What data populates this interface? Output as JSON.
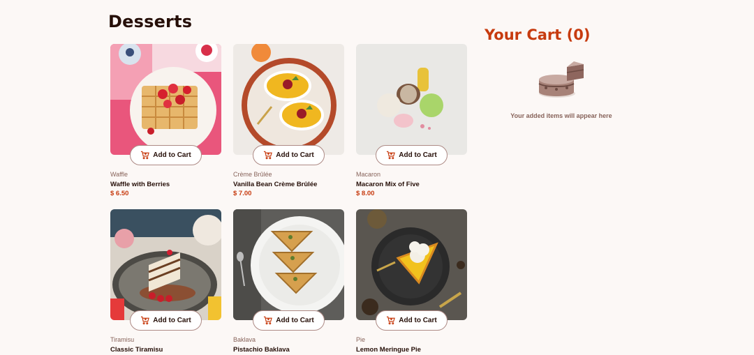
{
  "page": {
    "title": "Desserts"
  },
  "products": [
    {
      "category": "Waffle",
      "name": "Waffle with Berries",
      "price": "$ 6.50",
      "button": "Add to Cart"
    },
    {
      "category": "Crème Brûlée",
      "name": "Vanilla Bean Crème Brûlée",
      "price": "$ 7.00",
      "button": "Add to Cart"
    },
    {
      "category": "Macaron",
      "name": "Macaron Mix of Five",
      "price": "$ 8.00",
      "button": "Add to Cart"
    },
    {
      "category": "Tiramisu",
      "name": "Classic Tiramisu",
      "price": "",
      "button": "Add to Cart"
    },
    {
      "category": "Baklava",
      "name": "Pistachio Baklava",
      "price": "",
      "button": "Add to Cart"
    },
    {
      "category": "Pie",
      "name": "Lemon Meringue Pie",
      "price": "",
      "button": "Add to Cart"
    }
  ],
  "cart": {
    "title": "Your Cart (0)",
    "empty_message": "Your added items will appear here"
  },
  "colors": {
    "accent": "#c73b0f",
    "text": "#260f08",
    "muted": "#87635a",
    "background": "#fcf8f6"
  }
}
